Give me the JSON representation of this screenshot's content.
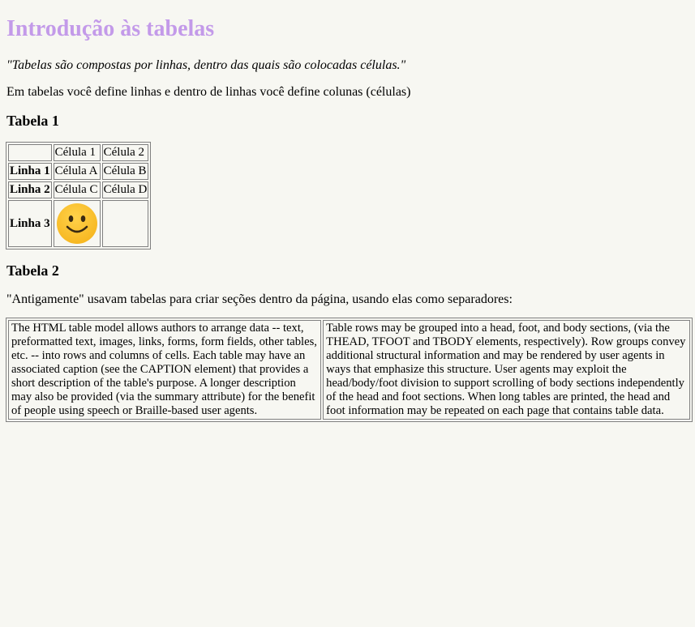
{
  "page": {
    "title": "Introdução às tabelas",
    "quote": "\"Tabelas são compostas por linhas, dentro das quais são colocadas células.\"",
    "intro": "Em tabelas você define linhas e dentro de linhas você define colunas (células)",
    "accent_color": "#c39ae9",
    "background_color": "#f7f7f2"
  },
  "table1": {
    "heading": "Tabela 1",
    "header_row": [
      "",
      "Célula 1",
      "Célula 2"
    ],
    "rows": [
      {
        "label": "Linha 1",
        "cells": [
          "Célula A",
          "Célula B"
        ]
      },
      {
        "label": "Linha 2",
        "cells": [
          "Célula C",
          "Célula D"
        ]
      },
      {
        "label": "Linha 3",
        "cells": [
          "",
          ""
        ],
        "image": "smiley-face-icon"
      }
    ]
  },
  "table2": {
    "heading": "Tabela 2",
    "description": "\"Antigamente\" usavam tabelas para criar seções dentro da página, usando elas como separadores:",
    "left_text": "The HTML table model allows authors to arrange data -- text, preformatted text, images, links, forms, form fields, other tables, etc. -- into rows and columns of cells. Each table may have an associated caption (see the CAPTION element) that provides a short description of the table's purpose. A longer description may also be provided (via the summary attribute) for the benefit of people using speech or Braille-based user agents.",
    "right_text": "Table rows may be grouped into a head, foot, and body sections, (via the THEAD, TFOOT and TBODY elements, respectively). Row groups convey additional structural information and may be rendered by user agents in ways that emphasize this structure. User agents may exploit the head/body/foot division to support scrolling of body sections independently of the head and foot sections. When long tables are printed, the head and foot information may be repeated on each page that contains table data."
  }
}
